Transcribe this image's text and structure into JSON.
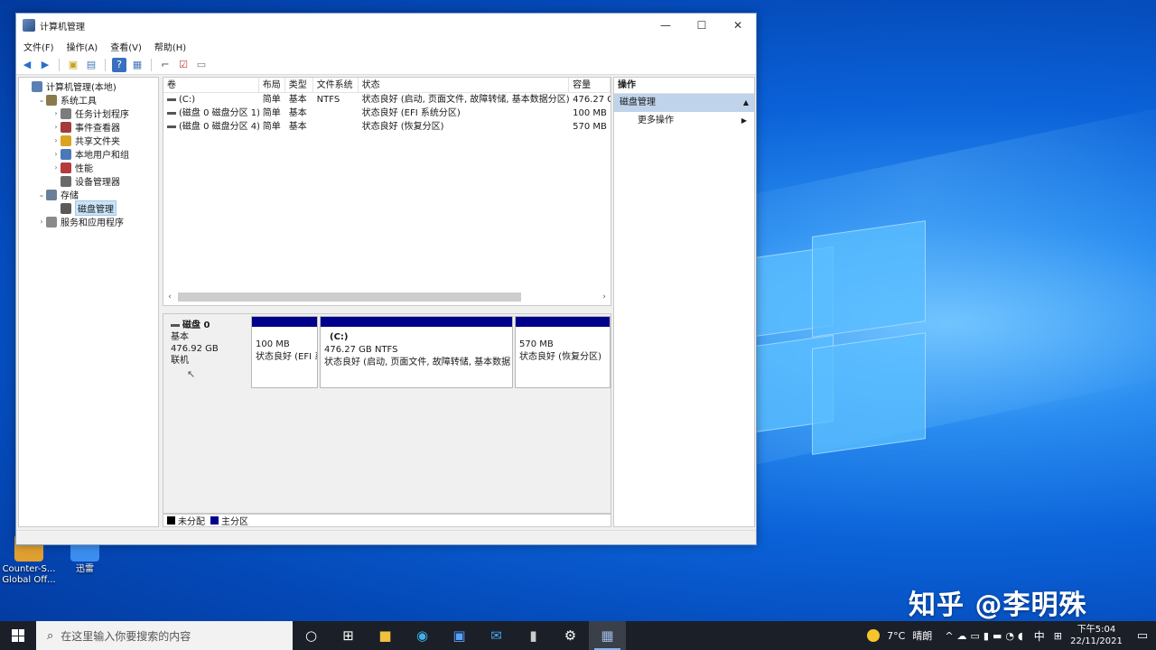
{
  "window": {
    "title": "计算机管理",
    "controls": [
      "—",
      "☐",
      "✕"
    ]
  },
  "menu": [
    "文件(F)",
    "操作(A)",
    "查看(V)",
    "帮助(H)"
  ],
  "tree": [
    {
      "label": "计算机管理(本地)",
      "indent": 0,
      "expander": "",
      "color": "#5b7fb5"
    },
    {
      "label": "系统工具",
      "indent": 1,
      "expander": "⌄",
      "color": "#8a7a4a"
    },
    {
      "label": "任务计划程序",
      "indent": 2,
      "expander": "›",
      "color": "#7c7c7c"
    },
    {
      "label": "事件查看器",
      "indent": 2,
      "expander": "›",
      "color": "#a33b3b"
    },
    {
      "label": "共享文件夹",
      "indent": 2,
      "expander": "›",
      "color": "#d9a520"
    },
    {
      "label": "本地用户和组",
      "indent": 2,
      "expander": "›",
      "color": "#4a78b9"
    },
    {
      "label": "性能",
      "indent": 2,
      "expander": "›",
      "color": "#b53a3a"
    },
    {
      "label": "设备管理器",
      "indent": 2,
      "expander": "",
      "color": "#6a6a6a"
    },
    {
      "label": "存储",
      "indent": 1,
      "expander": "⌄",
      "color": "#6c7f99"
    },
    {
      "label": "磁盘管理",
      "indent": 2,
      "expander": "",
      "color": "#5a5a5a",
      "selected": true
    },
    {
      "label": "服务和应用程序",
      "indent": 1,
      "expander": "›",
      "color": "#8a8a8a"
    }
  ],
  "volumes": {
    "headers": [
      "卷",
      "布局",
      "类型",
      "文件系统",
      "状态",
      "容量"
    ],
    "rows": [
      [
        "(C:)",
        "简单",
        "基本",
        "NTFS",
        "状态良好 (启动, 页面文件, 故障转储, 基本数据分区)",
        "476.27 G"
      ],
      [
        "(磁盘 0 磁盘分区 1)",
        "简单",
        "基本",
        "",
        "状态良好 (EFI 系统分区)",
        "100 MB"
      ],
      [
        "(磁盘 0 磁盘分区 4)",
        "简单",
        "基本",
        "",
        "状态良好 (恢复分区)",
        "570 MB"
      ]
    ]
  },
  "disk": {
    "name": "磁盘 0",
    "type": "基本",
    "size": "476.92 GB",
    "status": "联机",
    "partitions": [
      {
        "title": "",
        "line1": "100 MB",
        "line2": "状态良好 (EFI 系",
        "width": 74
      },
      {
        "title": "(C:)",
        "line1": "476.27 GB NTFS",
        "line2": "状态良好 (启动, 页面文件, 故障转储, 基本数据",
        "width": 214
      },
      {
        "title": "",
        "line1": "570 MB",
        "line2": "状态良好 (恢复分区)",
        "width": 106
      }
    ]
  },
  "legend": [
    {
      "label": "未分配",
      "color": "#000000"
    },
    {
      "label": "主分区",
      "color": "#00008b"
    }
  ],
  "actions": {
    "header": "操作",
    "section": "磁盘管理",
    "item": "更多操作"
  },
  "desktop": {
    "icons": [
      {
        "label": "Counter-S... Global Off...",
        "color": "#e0a030"
      },
      {
        "label": "迅雷",
        "color": "#3a8ef0"
      }
    ],
    "watermark": "知乎 @李明殊"
  },
  "taskbar": {
    "search_placeholder": "在这里输入你要搜索的内容",
    "weather_temp": "7°C",
    "weather_desc": "晴朗",
    "ime": "中",
    "time": "下午5:04",
    "date": "22/11/2021"
  }
}
